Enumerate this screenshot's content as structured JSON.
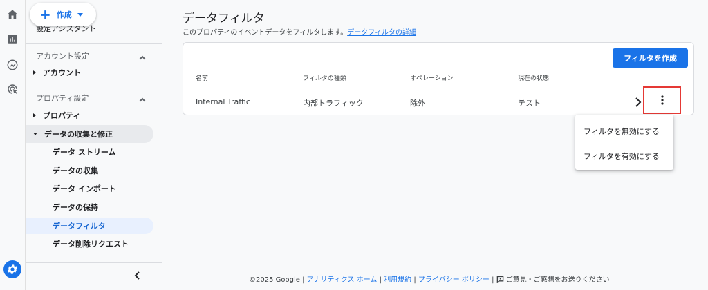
{
  "create": {
    "label": "作成"
  },
  "sidebar": {
    "partial_item": "設定アシスタント",
    "account_section": "アカウント設定",
    "account_item": "アカウント",
    "property_section": "プロパティ設定",
    "property_item": "プロパティ",
    "data_section": "データの収集と修正",
    "sub_items": [
      "データ ストリーム",
      "データの収集",
      "データ インポート",
      "データの保持",
      "データフィルタ",
      "データ削除リクエスト"
    ]
  },
  "page": {
    "title": "データフィルタ",
    "description": "このプロパティのイベントデータをフィルタします。",
    "description_link": "データフィルタの詳細",
    "create_button": "フィルタを作成"
  },
  "table": {
    "headers": [
      "名前",
      "フィルタの種類",
      "オペレーション",
      "現在の状態"
    ],
    "rows": [
      {
        "name": "Internal Traffic",
        "type": "内部トラフィック",
        "operation": "除外",
        "status": "テスト"
      }
    ]
  },
  "menu": {
    "items": [
      "フィルタを無効にする",
      "フィルタを有効にする"
    ]
  },
  "footer": {
    "copyright": "©2025 Google",
    "sep": "|",
    "links": [
      "アナリティクス ホーム",
      "利用規約",
      "プライバシー ポリシー"
    ],
    "feedback": "ご意見・ご感想をお送りください"
  },
  "colors": {
    "accent": "#1a73e8",
    "highlight_border": "#e53935"
  }
}
